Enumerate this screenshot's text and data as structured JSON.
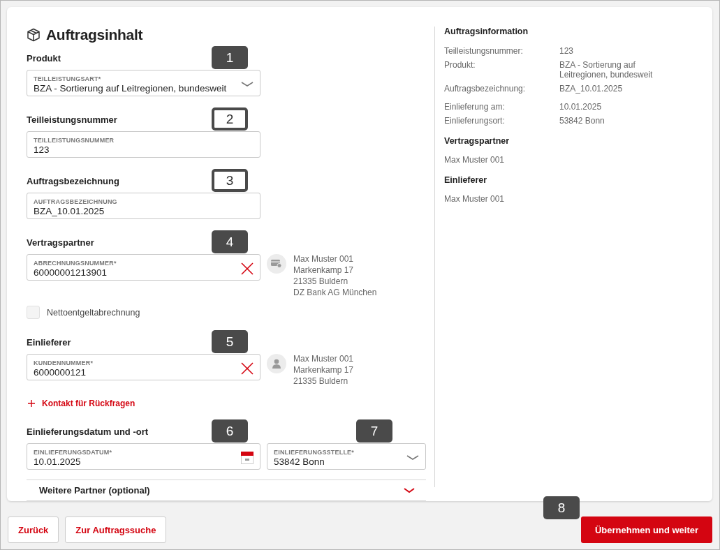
{
  "content": {
    "title": "Auftragsinhalt",
    "sections": [
      {
        "label": "Produkt",
        "fields": [
          {
            "kind": "select",
            "label": "TEILLEISTUNGSART*",
            "value": "BZA - Sortierung auf Leitregionen, bundesweit",
            "badge": {
              "text": "1",
              "kind": "filled"
            }
          }
        ]
      },
      {
        "label": "Teilleistungsnummer",
        "fields": [
          {
            "kind": "text",
            "label": "TEILLEISTUNGSNUMMER",
            "value": "123",
            "badge": {
              "text": "2",
              "kind": "outlined"
            }
          }
        ]
      },
      {
        "label": "Auftragsbezeichnung",
        "fields": [
          {
            "kind": "text",
            "label": "AUFTRAGSBEZEICHNUNG",
            "value": "BZA_10.01.2025",
            "badge": {
              "text": "3",
              "kind": "outlined"
            }
          }
        ]
      },
      {
        "label": "Vertragspartner",
        "fields": [
          {
            "kind": "clearable",
            "label": "ABRECHNUNGSNUMMER*",
            "value": "60000001213901",
            "badge": {
              "text": "4",
              "kind": "filled"
            }
          }
        ],
        "details": {
          "kind": "billing",
          "lines": [
            "Max Muster 001",
            "Markenkamp 17",
            "21335 Buldern",
            "DZ Bank AG München"
          ]
        },
        "checkbox": {
          "label": "Nettoentgeltabrechnung",
          "checked": false
        }
      },
      {
        "label": "Einlieferer",
        "fields": [
          {
            "kind": "clearable",
            "label": "KUNDENNUMMER*",
            "value": "6000000121",
            "badge": {
              "text": "5",
              "kind": "filled"
            }
          }
        ],
        "details": {
          "kind": "sender",
          "lines": [
            "Max Muster 001",
            "Markenkamp 17",
            "21335 Buldern"
          ]
        },
        "link": "Kontakt für Rückfragen"
      },
      {
        "label": "Einlieferungsdatum und -ort",
        "fields": [
          {
            "kind": "date",
            "label": "EINLIEFERUNGSDATUM*",
            "value": "10.01.2025",
            "badge": {
              "text": "6",
              "kind": "filled"
            }
          },
          {
            "kind": "select",
            "label": "EINLIEFERUNGSSTELLE*",
            "value": "53842 Bonn",
            "badge": {
              "text": "7",
              "kind": "filled"
            }
          }
        ]
      }
    ],
    "accordion": {
      "label": "Weitere Partner (optional)",
      "expanded": false
    }
  },
  "summary": {
    "title": "Auftragsinformation",
    "groups": [
      [
        {
          "label": "Teilleistungsnummer:",
          "value": "123"
        },
        {
          "label": "Produkt:",
          "value": "BZA - Sortierung auf Leitregionen, bundesweit"
        },
        {
          "label": "Auftragsbezeichnung:",
          "value": "BZA_10.01.2025"
        }
      ],
      [
        {
          "label": "Einlieferung am:",
          "value": "10.01.2025"
        },
        {
          "label": "Einlieferungsort:",
          "value": "53842 Bonn"
        }
      ]
    ],
    "parties": [
      {
        "title": "Vertragspartner",
        "value": "Max Muster 001"
      },
      {
        "title": "Einlieferer",
        "value": "Max Muster 001"
      }
    ]
  },
  "footer": {
    "buttons": [
      {
        "label": "Zurück",
        "kind": "secondary"
      },
      {
        "label": "Zur Auftragssuche",
        "kind": "secondary"
      },
      {
        "label": "Übernehmen und weiter",
        "kind": "primary",
        "badge": {
          "text": "8",
          "kind": "filled"
        }
      }
    ]
  }
}
